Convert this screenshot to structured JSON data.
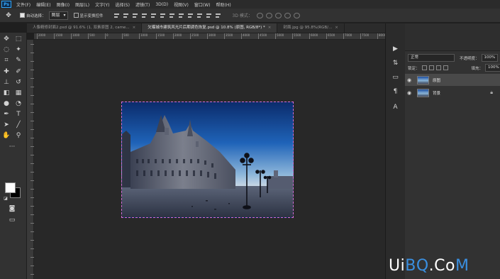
{
  "app": {
    "logo": "Ps"
  },
  "menu": [
    "文件(F)",
    "编辑(E)",
    "图像(I)",
    "图层(L)",
    "文字(Y)",
    "选择(S)",
    "滤镜(T)",
    "3D(D)",
    "视图(V)",
    "窗口(W)",
    "帮助(H)"
  ],
  "options": {
    "auto_select_label": "自动选择：",
    "auto_select_value": "图层",
    "show_transform_label": "显示变换控件",
    "mode_3d_label": "3D 模式："
  },
  "tabs": [
    {
      "label": "人像精修封面2.psd @ 91.6% (1, 双素原图 2, came...",
      "active": false
    },
    {
      "label": "欠曝城市建筑风光片后期调色恢复.psd @ 10.8% (原图, RGB/8*) *",
      "active": true
    },
    {
      "label": "封面.jpg @ 95.8%(RGB/...",
      "active": false
    }
  ],
  "ruler_labels": [
    "2000",
    "1500",
    "1000",
    "500",
    "0",
    "500",
    "1000",
    "1500",
    "2000",
    "2500",
    "3000",
    "3500",
    "4000",
    "4500",
    "5000",
    "5500",
    "6000",
    "6500",
    "7000",
    "7500",
    "8000"
  ],
  "layers_panel": {
    "blend_mode": "正常",
    "opacity_label": "不透明度：",
    "opacity_value": "100%",
    "lock_label": "锁定：",
    "fill_label": "填充：",
    "fill_value": "100%",
    "layers": [
      {
        "name": "原图",
        "selected": true,
        "locked": false
      },
      {
        "name": "背景",
        "selected": false,
        "locked": true
      }
    ]
  },
  "watermark": {
    "text": "UiBQ.CoM",
    "color_main": "#ffffff",
    "color_accent": "#3a8fe0"
  },
  "colors": {
    "foreground": "#ffffff",
    "background": "#000000",
    "selection_border": "#d36bd5"
  },
  "icons": {
    "tools": [
      "move-icon",
      "marquee-icon",
      "lasso-icon",
      "magic-wand-icon",
      "crop-icon",
      "eyedropper-icon",
      "healing-icon",
      "brush-icon",
      "stamp-icon",
      "history-brush-icon",
      "eraser-icon",
      "gradient-icon",
      "blur-icon",
      "dodge-icon",
      "pen-icon",
      "type-icon",
      "path-select-icon",
      "shape-icon",
      "hand-icon",
      "zoom-icon",
      "more-icon"
    ],
    "dock": [
      "play-icon",
      "adjust-icon",
      "layers-icon",
      "channels-icon",
      "paragraph-icon"
    ]
  }
}
